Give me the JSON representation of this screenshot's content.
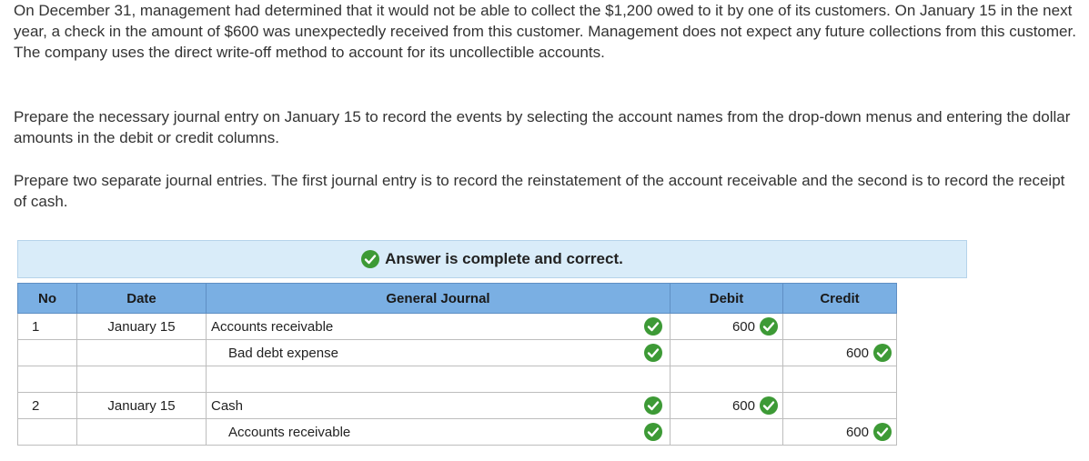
{
  "question": {
    "paragraph_1": "On December 31, management had determined that it would not be able to collect the $1,200 owed to it by one of its customers. On January 15 in the next year, a check in the amount of $600 was unexpectedly received from this customer. Management does not expect any future collections from this customer. The company uses the direct write-off method to account for its uncollectible accounts.",
    "paragraph_2": "Prepare the necessary journal entry on January 15 to record the events by selecting the account names from the drop-down menus and entering the dollar amounts in the debit or credit columns.",
    "paragraph_3": "Prepare two separate journal entries. The first journal entry is to record the reinstatement of the account receivable and the second is to record the receipt of cash."
  },
  "banner": {
    "text": "Answer is complete and correct.",
    "icon": "check-circle-icon"
  },
  "journal": {
    "headers": {
      "no": "No",
      "date": "Date",
      "general_journal": "General Journal",
      "debit": "Debit",
      "credit": "Credit"
    },
    "rows": [
      {
        "no": "1",
        "date": "January 15",
        "account": "Accounts receivable",
        "debit": "600",
        "credit": ""
      },
      {
        "no": "",
        "date": "",
        "account": "Bad debt expense",
        "debit": "",
        "credit": "600"
      },
      {
        "no": "2",
        "date": "January 15",
        "account": "Cash",
        "debit": "600",
        "credit": ""
      },
      {
        "no": "",
        "date": "",
        "account": "Accounts receivable",
        "debit": "",
        "credit": "600"
      }
    ]
  },
  "colors": {
    "header_bg": "#7aafe3",
    "banner_bg": "#d9ecf9",
    "check_green": "#3d9a36"
  }
}
